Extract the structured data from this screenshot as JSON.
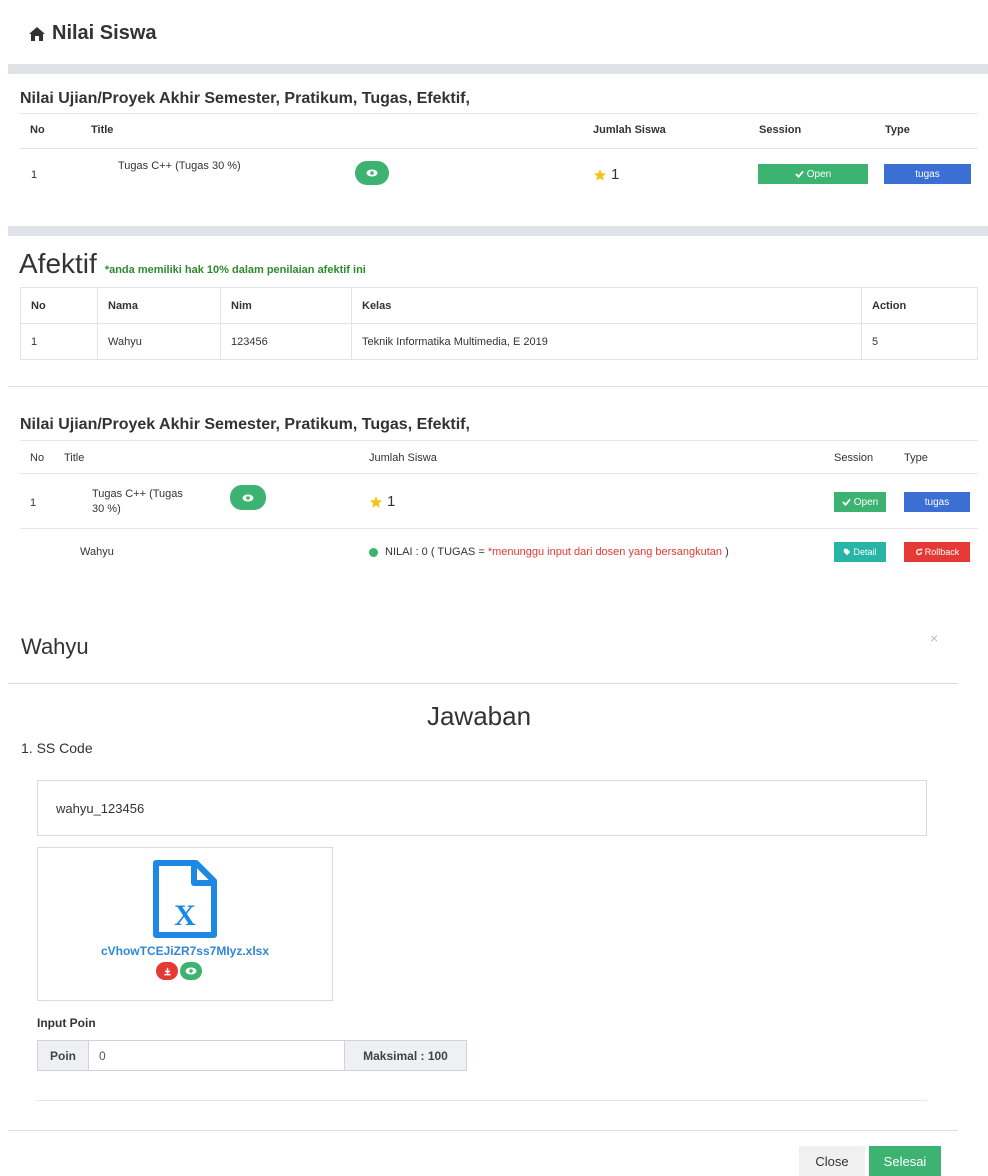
{
  "page": {
    "title": "Nilai Siswa",
    "home_icon": "home-icon"
  },
  "section1": {
    "heading": "Nilai Ujian/Proyek Akhir Semester, Pratikum, Tugas, Efektif,",
    "columns": [
      "No",
      "Title",
      "Jumlah Siswa",
      "Session",
      "Type"
    ],
    "row": {
      "no": "1",
      "title": "Tugas C++ (Tugas 30 %)",
      "count": "1",
      "session": "Open",
      "type": "tugas"
    }
  },
  "afektif": {
    "title": "Afektif",
    "note": "*anda memiliki hak 10% dalam penilaian afektif ini",
    "columns": [
      "No",
      "Nama",
      "Nim",
      "Kelas",
      "Action"
    ],
    "row": {
      "no": "1",
      "nama": "Wahyu",
      "nim": "123456",
      "kelas": "Teknik Informatika Multimedia, E 2019",
      "action": "5"
    }
  },
  "section3": {
    "heading": "Nilai Ujian/Proyek Akhir Semester, Pratikum, Tugas, Efektif,",
    "columns": [
      "No",
      "Title",
      "Jumlah Siswa",
      "Session",
      "Type"
    ],
    "row": {
      "no": "1",
      "title_line1": "Tugas C++ (Tugas",
      "title_line2": "30 %)",
      "count": "1",
      "session": "Open",
      "type": "tugas"
    },
    "student": {
      "name": "Wahyu",
      "nilai_prefix": "NILAI : 0 ( TUGAS = ",
      "nilai_status": "*menunggu input dari dosen yang bersangkutan",
      "nilai_suffix": " )",
      "detail_label": "Detail",
      "rollback_label": "Rollback"
    }
  },
  "modal": {
    "title": "Wahyu",
    "close_symbol": "×",
    "heading": "Jawaban",
    "question": "1. SS Code",
    "answer": "wahyu_123456",
    "file_name": "cVhowTCEJiZR7ss7MIyz.xlsx",
    "input_label": "Input Poin",
    "poin_label": "Poin",
    "poin_value": "0",
    "max_label": "Maksimal : 100",
    "close_label": "Close",
    "submit_label": "Selesai"
  },
  "colors": {
    "green": "#3cb371",
    "blue": "#3b6fd4",
    "red": "#e53935",
    "teal": "#26b5a6",
    "link": "#2f87d6",
    "star": "#f5c518"
  }
}
